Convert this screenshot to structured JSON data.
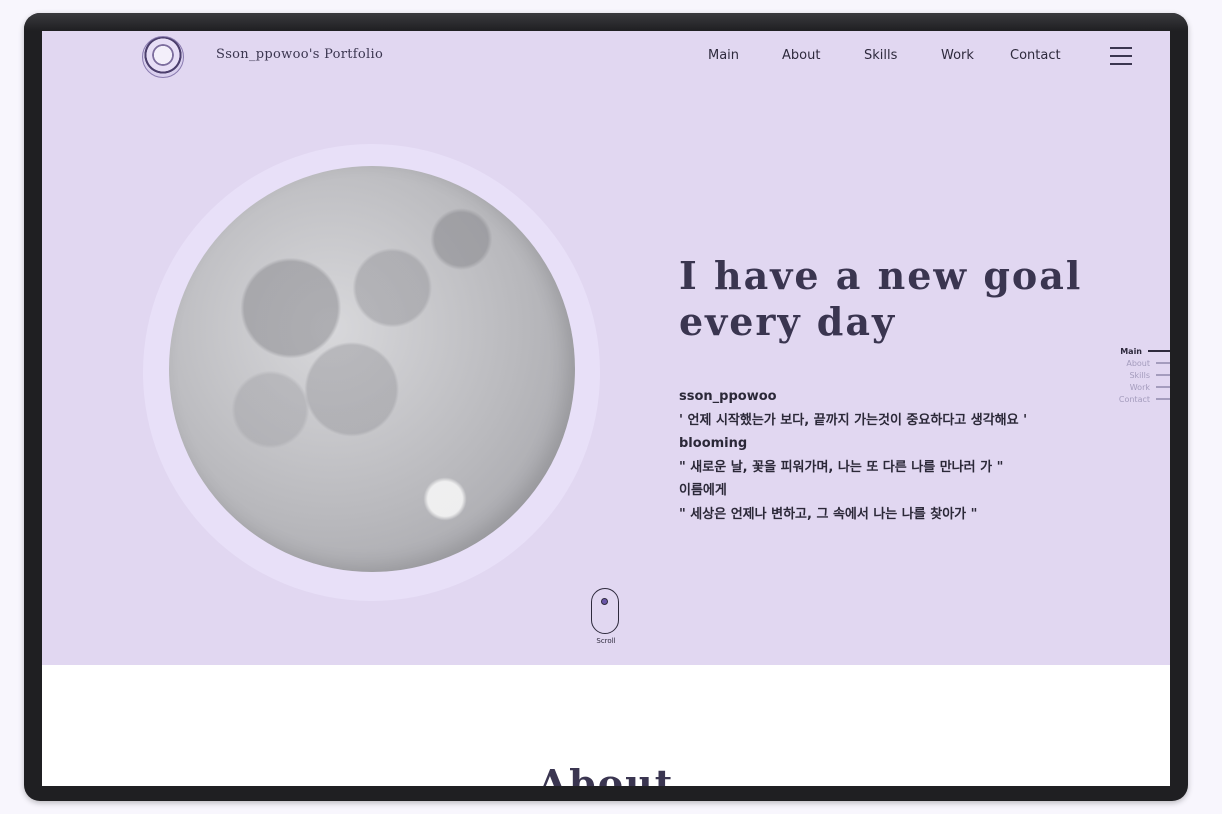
{
  "header": {
    "brand": "Sson_ppowoo's Portfolio",
    "nav": [
      "Main",
      "About",
      "Skills",
      "Work",
      "Contact"
    ]
  },
  "hero": {
    "headline_1": "I have a new goal",
    "headline_2": "every day",
    "lines": [
      "sson_ppowoo",
      "' 언제 시작했는가 보다, 끝까지 가는것이 중요하다고 생각해요 '",
      "blooming",
      "\" 새로운 날, 꽃을 피워가며, 나는 또 다른 나를 만나러 가 \"",
      "이름에게",
      "\" 세상은 언제나 변하고, 그 속에서 나는 나를 찾아가 \""
    ],
    "scroll_label": "Scroll"
  },
  "side_nav": [
    "Main",
    "About",
    "Skills",
    "Work",
    "Contact"
  ],
  "side_nav_active": "Main",
  "about": {
    "title": "About"
  },
  "colors": {
    "hero_bg": "#e1d7f1",
    "text": "#3a3550",
    "accent": "#6a55a8"
  }
}
